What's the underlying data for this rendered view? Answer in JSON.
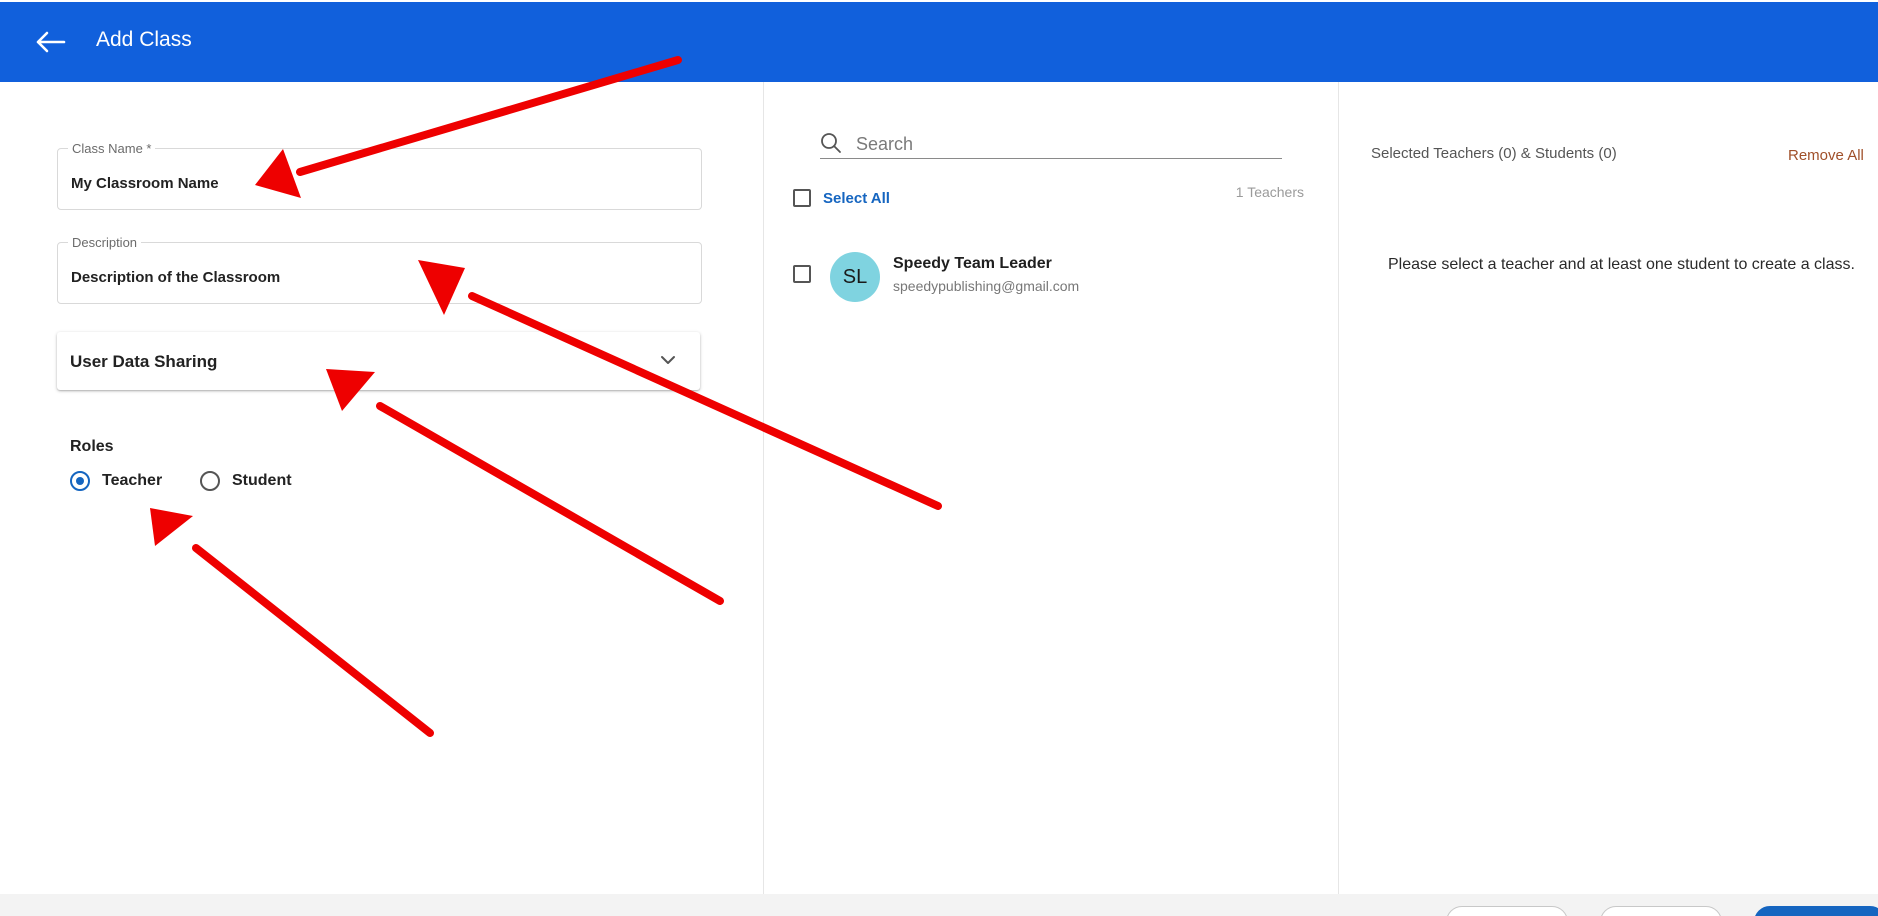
{
  "header": {
    "title": "Add Class",
    "back_icon": "arrow-left-icon"
  },
  "form": {
    "class_name": {
      "label": "Class Name *",
      "value": "My Classroom Name"
    },
    "description": {
      "label": "Description",
      "value": "Description of the Classroom"
    },
    "user_data_sharing": {
      "label": "User Data Sharing"
    },
    "roles": {
      "label": "Roles",
      "options": [
        {
          "label": "Teacher",
          "selected": true
        },
        {
          "label": "Student",
          "selected": false
        }
      ]
    }
  },
  "people": {
    "search_placeholder": "Search",
    "select_all_label": "Select All",
    "count_label": "1 Teachers",
    "users": [
      {
        "initials": "SL",
        "name": "Speedy Team Leader",
        "email": "speedypublishing@gmail.com"
      }
    ]
  },
  "selection": {
    "heading": "Selected Teachers (0) & Students (0)",
    "remove_all_label": "Remove All",
    "empty_message": "Please select a teacher and at least one student to create a class."
  },
  "colors": {
    "header_bg": "#1160dc",
    "accent": "#1565c0",
    "annotation": "#ee0000",
    "remove_all": "#a0502a",
    "avatar_bg": "#7fd3e0"
  }
}
